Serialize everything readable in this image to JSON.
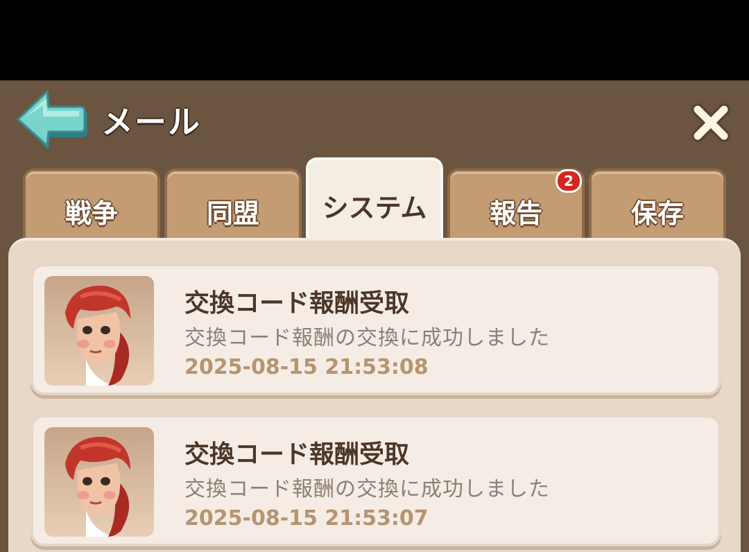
{
  "header": {
    "title": "メール",
    "back_icon": "back-arrow-icon",
    "close_icon": "close-icon"
  },
  "tabs": [
    {
      "label": "戦争",
      "active": false
    },
    {
      "label": "同盟",
      "active": false
    },
    {
      "label": "システム",
      "active": true
    },
    {
      "label": "報告",
      "active": false,
      "badge": "2"
    },
    {
      "label": "保存",
      "active": false
    }
  ],
  "mails": [
    {
      "title": "交換コード報酬受取",
      "body": "交換コード報酬の交換に成功しました",
      "time": "2025-08-15 21:53:08",
      "avatar_icon": "red-haired-woman-portrait"
    },
    {
      "title": "交換コード報酬受取",
      "body": "交換コード報酬の交換に成功しました",
      "time": "2025-08-15 21:53:07",
      "avatar_icon": "red-haired-woman-portrait"
    }
  ],
  "colors": {
    "panel_bg": "#6b5540",
    "tab_bg": "#c39c74",
    "tab_active_bg": "#f4ede3",
    "card_bg": "#f5ede5",
    "badge": "#d62420",
    "back_arrow": "#6fcfc8"
  }
}
